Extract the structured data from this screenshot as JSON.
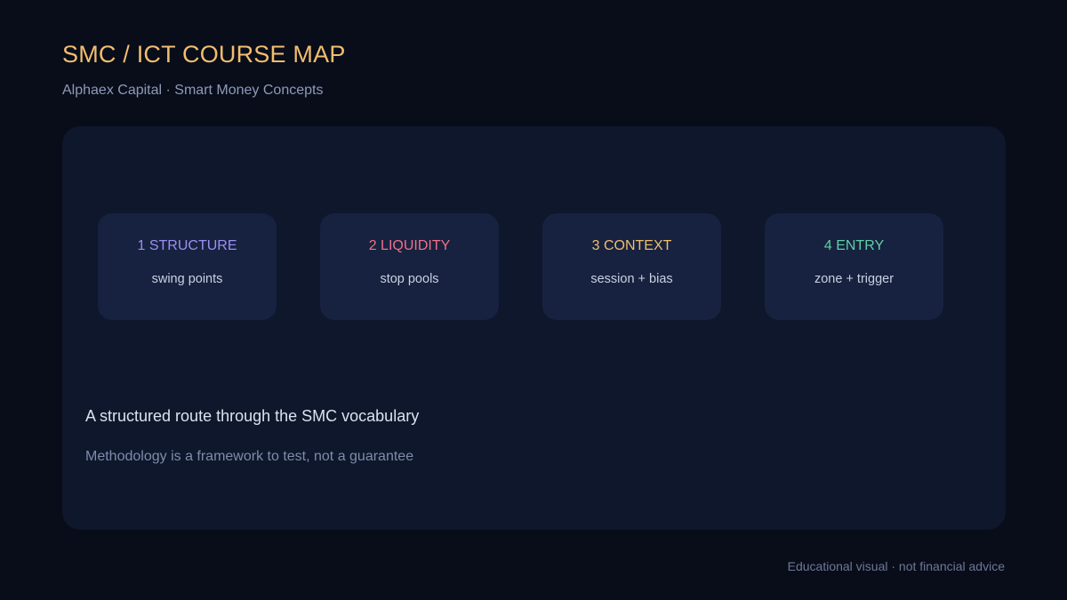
{
  "header": {
    "title": "SMC / ICT COURSE MAP",
    "subtitle": "Alphaex Capital · Smart Money Concepts"
  },
  "steps": [
    {
      "label": "1 STRUCTURE",
      "description": "swing points",
      "accent_color": "#9d8ef2"
    },
    {
      "label": "2 LIQUIDITY",
      "description": "stop pools",
      "accent_color": "#f0708a"
    },
    {
      "label": "3 CONTEXT",
      "description": "session + bias",
      "accent_color": "#f3bd6f"
    },
    {
      "label": "4 ENTRY",
      "description": "zone + trigger",
      "accent_color": "#5fd0a6"
    }
  ],
  "panel": {
    "heading": "A structured route through the SMC vocabulary",
    "note": "Methodology is a framework to test, not a guarantee"
  },
  "footer": {
    "disclaimer": "Educational visual · not financial advice"
  },
  "colors": {
    "background": "#080d19",
    "panel": "#0e172b",
    "card": "#16223f",
    "title": "#f3bd6f"
  }
}
